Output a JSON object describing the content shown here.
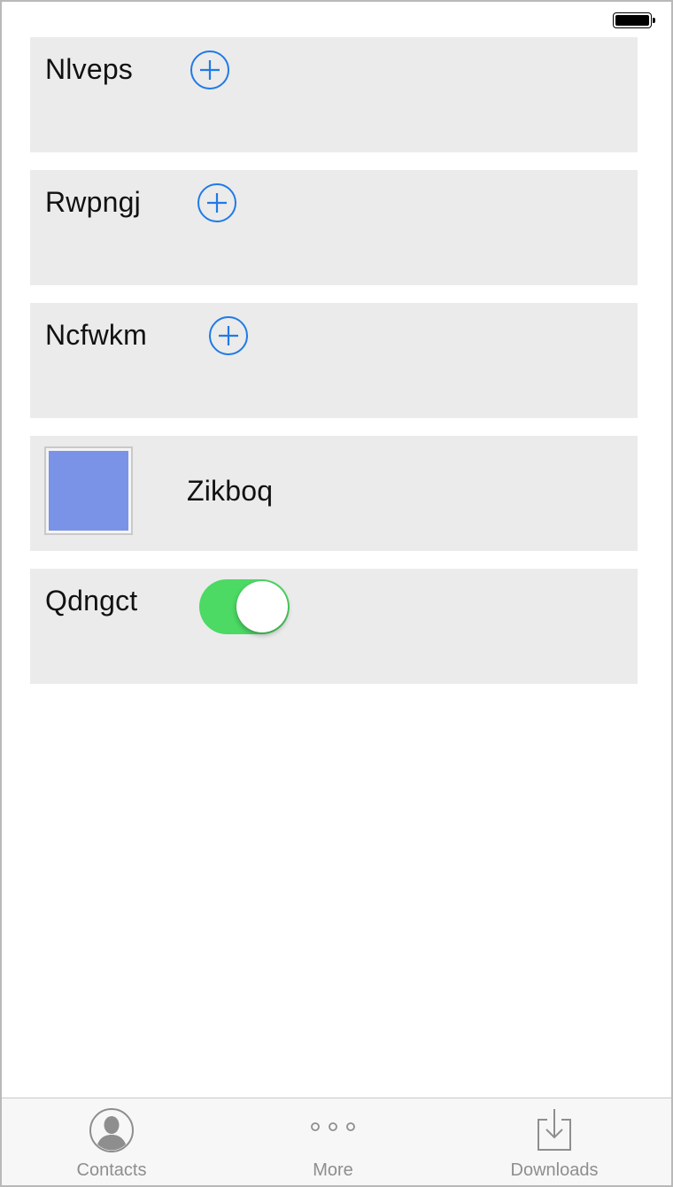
{
  "status_bar": {
    "battery": "full"
  },
  "rows": [
    {
      "label": "Nlveps",
      "accessory": "add-icon"
    },
    {
      "label": "Rwpngj",
      "accessory": "add-icon"
    },
    {
      "label": "Ncfwkm",
      "accessory": "add-icon"
    },
    {
      "label": "Zikboq",
      "accessory": "image-thumbnail",
      "thumbnail_color": "#7b93e6"
    },
    {
      "label": "Qdngct",
      "accessory": "toggle-switch",
      "toggle_on": true
    }
  ],
  "tabbar": {
    "tabs": [
      {
        "label": "Contacts",
        "icon": "contacts-icon"
      },
      {
        "label": "More",
        "icon": "more-icon"
      },
      {
        "label": "Downloads",
        "icon": "downloads-icon"
      }
    ]
  },
  "colors": {
    "accent": "#1f7ae6",
    "toggle_on": "#4cd964",
    "cell_bg": "#ebebeb"
  }
}
